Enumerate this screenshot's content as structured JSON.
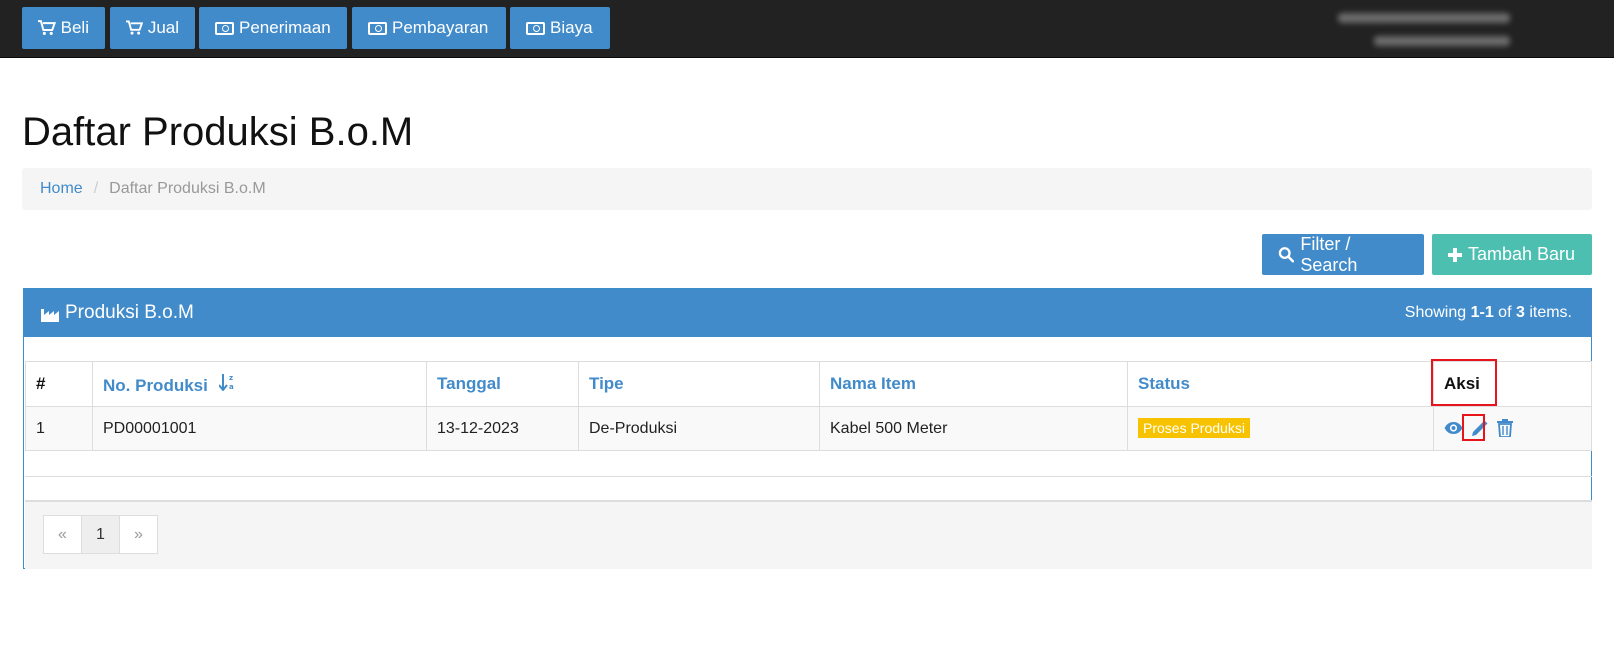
{
  "nav": {
    "items": [
      {
        "label": "Beli",
        "icon": "cart-icon"
      },
      {
        "label": "Jual",
        "icon": "cart-icon"
      },
      {
        "label": "Penerimaan",
        "icon": "cash-icon"
      },
      {
        "label": "Pembayaran",
        "icon": "cash-icon"
      },
      {
        "label": "Biaya",
        "icon": "cash-icon"
      }
    ]
  },
  "page": {
    "title": "Daftar Produksi B.o.M"
  },
  "breadcrumb": {
    "home": "Home",
    "current": "Daftar Produksi B.o.M"
  },
  "actions": {
    "filter_label": "Filter / Search",
    "add_label": "Tambah Baru"
  },
  "panel": {
    "title": "Produksi B.o.M",
    "showing_prefix": "Showing",
    "showing_range": "1-1",
    "showing_of": "of",
    "showing_total": "3",
    "showing_suffix": "items."
  },
  "table": {
    "headers": [
      "#",
      "No. Produksi",
      "Tanggal",
      "Tipe",
      "Nama Item",
      "Status",
      "Aksi"
    ],
    "rows": [
      {
        "no": "1",
        "code": "PD00001001",
        "date": "13-12-2023",
        "type": "De-Produksi",
        "item": "Kabel 500 Meter",
        "status": "Proses Produksi"
      }
    ]
  },
  "pagination": {
    "prev": "«",
    "page": "1",
    "next": "»"
  },
  "colors": {
    "primary": "#428bca",
    "teal": "#4cbfb1",
    "navbar": "#222222",
    "status_warning": "#f7c300",
    "highlight": "#e8141b"
  }
}
